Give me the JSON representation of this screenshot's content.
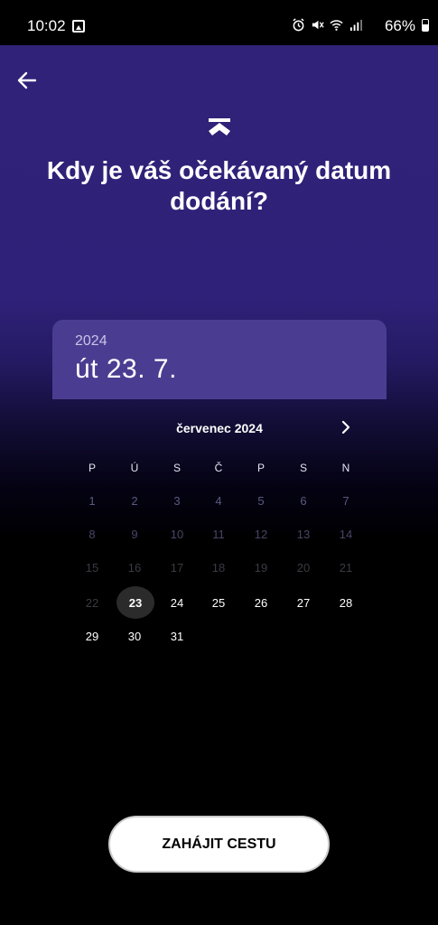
{
  "status": {
    "time": "10:02",
    "battery": "66%",
    "icons": [
      "image-icon",
      "alarm-icon",
      "mute-icon",
      "wifi-icon",
      "signal-icon",
      "battery-icon"
    ]
  },
  "header": {
    "back_icon": "arrow-left-icon",
    "logo_icon": "app-logo-icon",
    "title": "Kdy je váš očekávaný datum dodání?"
  },
  "selected": {
    "year": "2024",
    "date": "út 23. 7."
  },
  "calendar": {
    "month_label": "červenec 2024",
    "next_icon": "chevron-right-icon",
    "weekdays": [
      "P",
      "Ú",
      "S",
      "Č",
      "P",
      "S",
      "N"
    ],
    "weeks": [
      [
        "1",
        "2",
        "3",
        "4",
        "5",
        "6",
        "7"
      ],
      [
        "8",
        "9",
        "10",
        "11",
        "12",
        "13",
        "14"
      ],
      [
        "15",
        "16",
        "17",
        "18",
        "19",
        "20",
        "21"
      ],
      [
        "22",
        "23",
        "24",
        "25",
        "26",
        "27",
        "28"
      ],
      [
        "29",
        "30",
        "31"
      ]
    ],
    "selected_day": "23"
  },
  "footer": {
    "start_button": "ZAHÁJIT CESTU"
  },
  "colors": {
    "accent": "#2f2179",
    "card": "#4a3d91",
    "selected_day_bg": "#2b2b2b"
  }
}
